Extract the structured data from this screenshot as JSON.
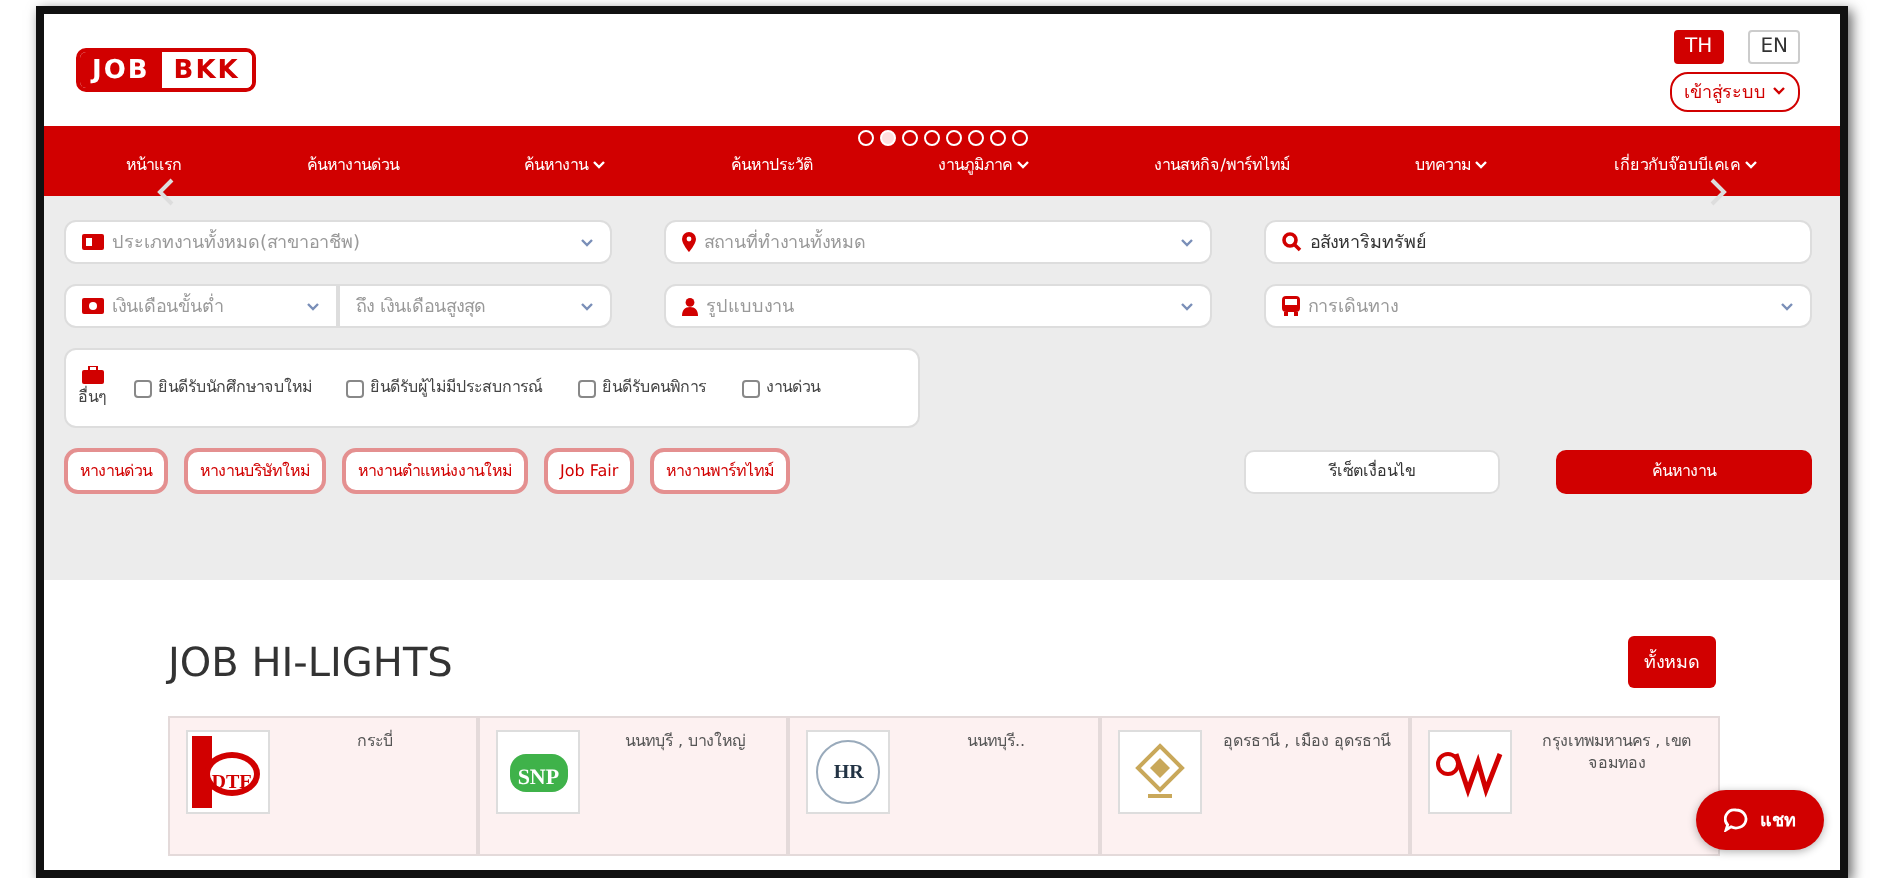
{
  "header": {
    "logo": {
      "left": "JOB",
      "right": "BKK"
    },
    "languages": [
      {
        "label": "TH",
        "selected": true
      },
      {
        "label": "EN",
        "selected": false
      }
    ],
    "login": "เข้าสู่ระบบ"
  },
  "nav": {
    "items": [
      {
        "label": "หน้าแรก",
        "has_menu": false
      },
      {
        "label": "ค้นหางานด่วน",
        "has_menu": false
      },
      {
        "label": "ค้นหางาน",
        "has_menu": true
      },
      {
        "label": "ค้นหาประวัติ",
        "has_menu": false
      },
      {
        "label": "งานภูมิภาค",
        "has_menu": true
      },
      {
        "label": "งานสหกิจ/พาร์ทไทม์",
        "has_menu": false
      },
      {
        "label": "บทความ",
        "has_menu": true
      },
      {
        "label": "เกี่ยวกับจ๊อบบีเคเค",
        "has_menu": true
      }
    ],
    "carousel_dots": [
      {
        "selected": false
      },
      {
        "selected": true
      },
      {
        "selected": false
      },
      {
        "selected": false
      },
      {
        "selected": false
      },
      {
        "selected": false
      },
      {
        "selected": false
      },
      {
        "selected": false
      }
    ]
  },
  "search": {
    "job_type": {
      "placeholder": "ประเภทงานทั้งหมด(สาขาอาชีพ)"
    },
    "location": {
      "placeholder": "สถานที่ทำงานทั้งหมด"
    },
    "keyword": {
      "value": "อสังหาริมทรัพย์"
    },
    "salary_min": {
      "placeholder": "เงินเดือนขั้นต่ำ"
    },
    "salary_max": {
      "placeholder": "ถึง เงินเดือนสูงสุด"
    },
    "work_type": {
      "placeholder": "รูปแบบงาน"
    },
    "travel": {
      "placeholder": "การเดินทาง"
    },
    "other_label": "อื่นๆ",
    "options": [
      {
        "label": "ยินดีรับนักศึกษาจบใหม่",
        "checked": false
      },
      {
        "label": "ยินดีรับผู้ไม่มีประสบการณ์",
        "checked": false
      },
      {
        "label": "ยินดีรับคนพิการ",
        "checked": false
      },
      {
        "label": "งานด่วน",
        "checked": false
      }
    ],
    "quick_links": [
      "หางานด่วน",
      "หางานบริษัทใหม่",
      "หางานตำแหน่งงานใหม่",
      "Job Fair",
      "หางานพาร์ทไทม์"
    ],
    "reset": "รีเซ็ตเงื่อนไข",
    "submit": "ค้นหางาน"
  },
  "highlights": {
    "title": "JOB HI-LIGHTS",
    "view_all": "ทั้งหมด",
    "items": [
      {
        "kind": "dte",
        "logo_text": "DTE",
        "location": "กระบี่"
      },
      {
        "kind": "snp",
        "logo_text": "SNP",
        "location": "นนทบุรี , บางใหญ่"
      },
      {
        "kind": "hr",
        "logo_text": "HR",
        "location": "นนทบุรี.."
      },
      {
        "kind": "diamond",
        "location": "อุดรธานี , เมือง อุดรธานี"
      },
      {
        "kind": "w",
        "location": "กรุงเทพมหานคร , เขตจอมทอง"
      }
    ]
  },
  "chat": "แชท"
}
